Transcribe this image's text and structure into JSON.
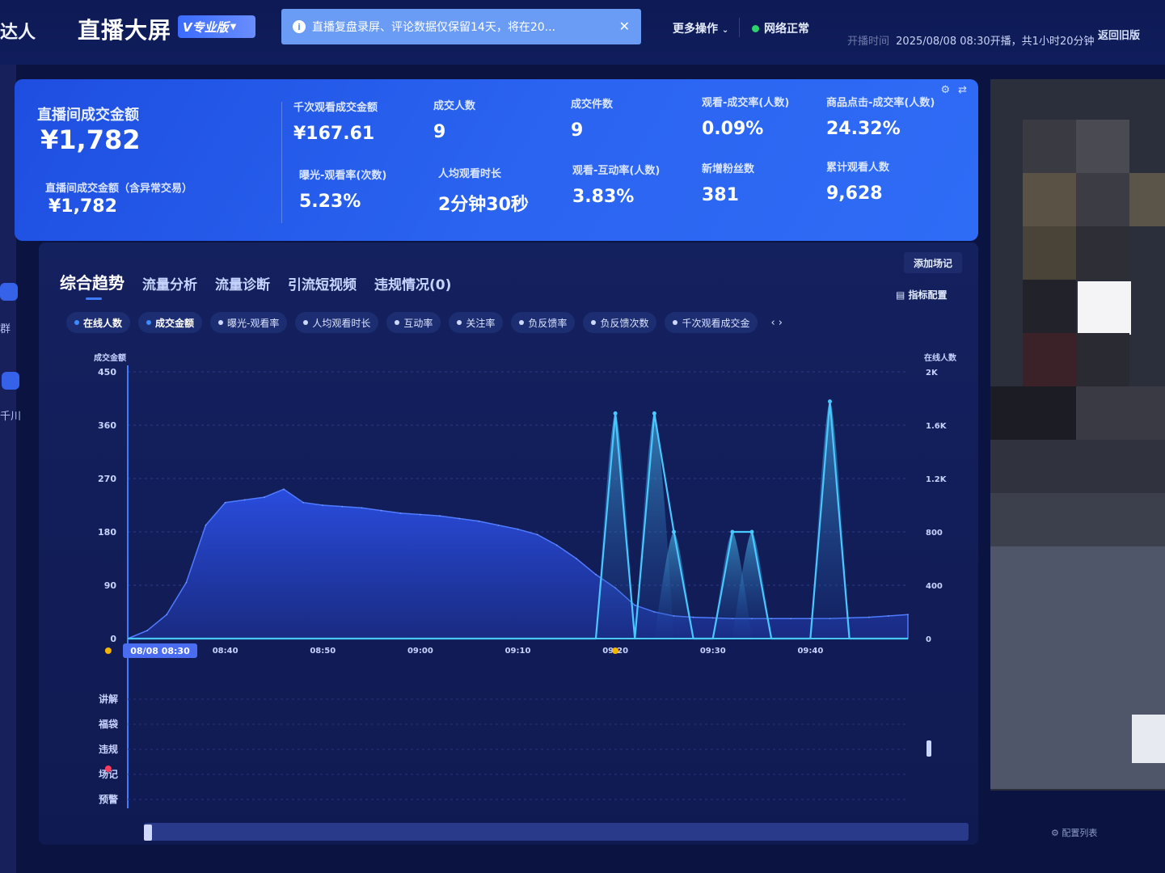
{
  "header": {
    "brand": "达人",
    "title": "直播大屏",
    "badge": "V专业版",
    "notice": "直播复盘录屏、评论数据仅保留14天，将在20...",
    "more_ops": "更多操作",
    "network": "网络正常",
    "start_time_label": "开播时间",
    "start_time_value": "2025/08/08 08:30开播，共1小时20分钟",
    "back_old": "返回旧版"
  },
  "kpi": {
    "main_label": "直播间成交金额",
    "main_value": "¥1,782",
    "sub_label": "直播间成交金额（含异常交易）",
    "sub_value": "¥1,782",
    "items": [
      {
        "label": "千次观看成交金额",
        "value": "¥167.61"
      },
      {
        "label": "成交人数",
        "value": "9"
      },
      {
        "label": "成交件数",
        "value": "9"
      },
      {
        "label": "观看-成交率(人数)",
        "value": "0.09%"
      },
      {
        "label": "商品点击-成交率(人数)",
        "value": "24.32%"
      },
      {
        "label": "曝光-观看率(次数)",
        "value": "5.23%"
      },
      {
        "label": "人均观看时长",
        "value": "2分钟30秒"
      },
      {
        "label": "观看-互动率(人数)",
        "value": "3.83%"
      },
      {
        "label": "新增粉丝数",
        "value": "381"
      },
      {
        "label": "累计观看人数",
        "value": "9,628"
      }
    ]
  },
  "left_edge": {
    "label_a": "群",
    "label_b": "千川"
  },
  "panel": {
    "tabs": [
      "综合趋势",
      "流量分析",
      "流量诊断",
      "引流短视频",
      "违规情况(0)"
    ],
    "add_mark": "添加场记",
    "metric_config": "指标配置",
    "chips": [
      {
        "label": "在线人数",
        "on": true
      },
      {
        "label": "成交金额",
        "on": true
      },
      {
        "label": "曝光-观看率",
        "on": false
      },
      {
        "label": "人均观看时长",
        "on": false
      },
      {
        "label": "互动率",
        "on": false
      },
      {
        "label": "关注率",
        "on": false
      },
      {
        "label": "负反馈率",
        "on": false
      },
      {
        "label": "负反馈次数",
        "on": false
      },
      {
        "label": "千次观看成交金",
        "on": false
      }
    ],
    "chip_arrows": "‹ ›",
    "config_list": "配置列表"
  },
  "colors": {
    "accent": "#3f7bff",
    "line": "#48c8ff",
    "area": "#2a4bd8",
    "marker_yellow": "#f5b400",
    "marker_red": "#ff3b5c"
  },
  "chart_data": {
    "type": "area",
    "x": [
      "08:30",
      "08:32",
      "08:34",
      "08:36",
      "08:38",
      "08:40",
      "08:42",
      "08:44",
      "08:46",
      "08:48",
      "08:50",
      "08:52",
      "08:54",
      "08:56",
      "08:58",
      "09:00",
      "09:02",
      "09:04",
      "09:06",
      "09:08",
      "09:10",
      "09:12",
      "09:14",
      "09:16",
      "09:18",
      "09:20",
      "09:22",
      "09:24",
      "09:26",
      "09:28",
      "09:30",
      "09:32",
      "09:34",
      "09:36",
      "09:38",
      "09:40",
      "09:42",
      "09:44",
      "09:46",
      "09:48",
      "09:50"
    ],
    "x_tick_labels": [
      "08/08 08:30",
      "08:40",
      "08:50",
      "09:00",
      "09:10",
      "09:20",
      "09:30",
      "09:40"
    ],
    "series": [
      {
        "name": "在线人数",
        "axis": "right",
        "values": [
          0,
          60,
          180,
          420,
          850,
          1020,
          1040,
          1060,
          1120,
          1020,
          1000,
          990,
          980,
          960,
          940,
          930,
          920,
          900,
          880,
          850,
          820,
          780,
          700,
          600,
          480,
          380,
          250,
          200,
          170,
          160,
          155,
          150,
          150,
          150,
          150,
          150,
          150,
          155,
          160,
          170,
          180
        ]
      },
      {
        "name": "成交金额",
        "axis": "left",
        "values": [
          0,
          0,
          0,
          0,
          0,
          0,
          0,
          0,
          0,
          0,
          0,
          0,
          0,
          0,
          0,
          0,
          0,
          0,
          0,
          0,
          0,
          0,
          0,
          0,
          0,
          380,
          0,
          380,
          180,
          0,
          0,
          180,
          180,
          0,
          0,
          0,
          400,
          0,
          0,
          0,
          0
        ]
      }
    ],
    "left_axis": {
      "label": "成交金额",
      "ticks": [
        0,
        90,
        180,
        270,
        360,
        450
      ],
      "ylim": [
        0,
        450
      ]
    },
    "right_axis": {
      "label": "在线人数",
      "ticks": [
        "0",
        "400",
        "800",
        "1.2K",
        "1.6K",
        "2K"
      ],
      "ylim": [
        0,
        2000
      ]
    },
    "lanes": [
      "讲解",
      "福袋",
      "违规",
      "场记",
      "预警"
    ],
    "lane_markers": [
      {
        "lane": "福袋",
        "x": "09:20",
        "color": "yellow"
      },
      {
        "lane": "福袋",
        "x": "09:25",
        "color": "yellow"
      },
      {
        "lane": "违规",
        "x": "09:25",
        "color": "red"
      }
    ]
  }
}
